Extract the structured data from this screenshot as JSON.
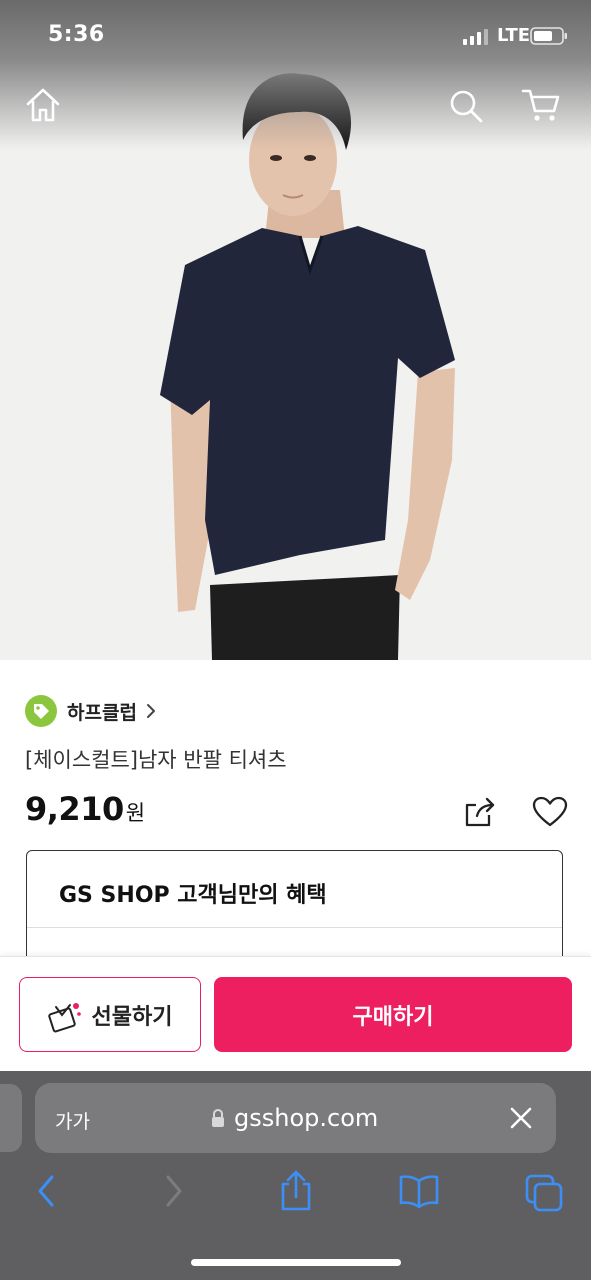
{
  "status_bar": {
    "time": "5:36",
    "network": "LTE"
  },
  "header": {
    "home_icon": "home-icon",
    "search_icon": "search-icon",
    "cart_icon": "cart-icon"
  },
  "product": {
    "brand": "하프클럽",
    "title": "[체이스컬트]남자 반팔 티셔츠",
    "price": "9,210",
    "currency": "원",
    "share_icon": "share-icon",
    "wishlist_icon": "heart-icon"
  },
  "benefit": {
    "title": "GS SHOP 고객님만의 혜택"
  },
  "actions": {
    "gift_label": "선물하기",
    "buy_label": "구매하기"
  },
  "browser": {
    "text_size_label": "가가",
    "url": "gsshop.com"
  },
  "colors": {
    "accent": "#ee1f60",
    "brand_badge": "#8cc63f",
    "safari_bg": "#5f5f61"
  }
}
